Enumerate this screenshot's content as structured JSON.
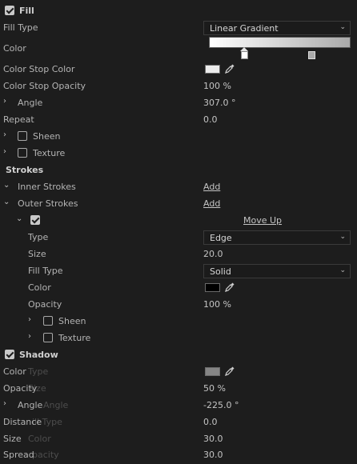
{
  "fill": {
    "title": "Fill",
    "fill_type_label": "Fill Type",
    "fill_type_value": "Linear Gradient",
    "color_label": "Color",
    "color_stop_color_label": "Color Stop Color",
    "color_stop_color": "#ececec",
    "color_stop_opacity_label": "Color Stop Opacity",
    "color_stop_opacity_value": "100 %",
    "angle_label": "Angle",
    "angle_value": "307.0 °",
    "repeat_label": "Repeat",
    "repeat_value": "0.0",
    "sheen_label": "Sheen",
    "texture_label": "Texture"
  },
  "strokes": {
    "title": "Strokes",
    "inner_label": "Inner Strokes",
    "inner_add": "Add",
    "outer_label": "Outer Strokes",
    "outer_add": "Add",
    "move_up": "Move Up",
    "type_label": "Type",
    "type_value": "Edge",
    "size_label": "Size",
    "size_value": "20.0",
    "fill_type_label": "Fill Type",
    "fill_type_value": "Solid",
    "color_label": "Color",
    "color_value": "#000000",
    "opacity_label": "Opacity",
    "opacity_value": "100 %",
    "sheen_label": "Sheen",
    "texture_label": "Texture"
  },
  "shadow": {
    "title": "Shadow",
    "color_label": "Color",
    "color_value": "#858585",
    "opacity_label": "Opacity",
    "opacity_value": "50 %",
    "angle_label": "Angle",
    "angle_value": "-225.0 °",
    "distance_label": "Distance",
    "distance_value": "0.0",
    "size_label": "Size",
    "size_value": "30.0",
    "spread_label": "Spread",
    "spread_value": "30.0"
  },
  "ghost": {
    "type": "Type",
    "size": "Size",
    "angle": "Angle",
    "fill_type": "ill Type",
    "color": "Color",
    "opacity": "pacity"
  }
}
